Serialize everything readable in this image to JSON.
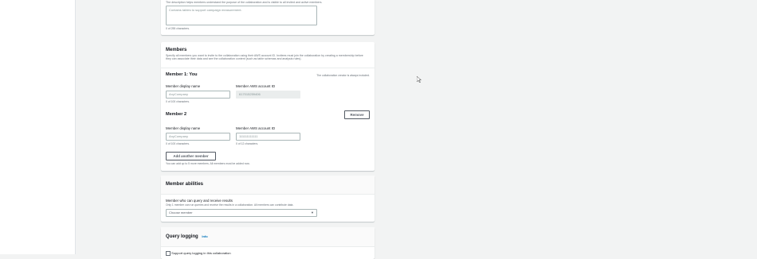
{
  "description_section": {
    "desc": "The description helps members understand the purpose of the collaboration and is visible to all invited and active members.",
    "textarea_placeholder": "Contains tables to support campaign measurement.",
    "char_hint": "0 of 255 characters."
  },
  "members": {
    "title": "Members",
    "desc": "Specify all members you want to invite to the collaboration using their AWS account ID. Invitees must join the collaboration by creating a membership before they can associate their data and see the collaboration content (such as table schemas and analysis rules).",
    "member1": {
      "title": "Member 1: You",
      "note": "The collaboration creator is always included.",
      "display_name_label": "Member display name",
      "display_name_value": "AnyCompany",
      "display_name_hint": "0 of 100 characters.",
      "account_label": "Member AWS account ID",
      "account_value": "617015259406"
    },
    "member2": {
      "title": "Member 2",
      "remove_label": "Remove",
      "display_name_label": "Member display name",
      "display_name_placeholder": "AnyCompany",
      "display_name_hint": "0 of 100 characters.",
      "account_label": "Member AWS account ID",
      "account_placeholder": "111111111111",
      "account_hint": "0 of 12 characters."
    },
    "add_member_label": "Add another member",
    "add_member_hint": "You can add up to 5 more members. All members must be added now."
  },
  "abilities": {
    "title": "Member abilities",
    "query_label": "Member who can query and receive results",
    "query_desc": "Only 1 member can run queries and receive the results in a collaboration. All members can contribute data.",
    "select_placeholder": "Choose member"
  },
  "query_logging": {
    "title": "Query logging",
    "info": "Info",
    "checkbox_label": "Support query logging in this collaboration"
  },
  "colors": {
    "background": "#f2f3f3",
    "panel": "#ffffff",
    "link": "#0073bb",
    "border": "#aab7b8"
  }
}
